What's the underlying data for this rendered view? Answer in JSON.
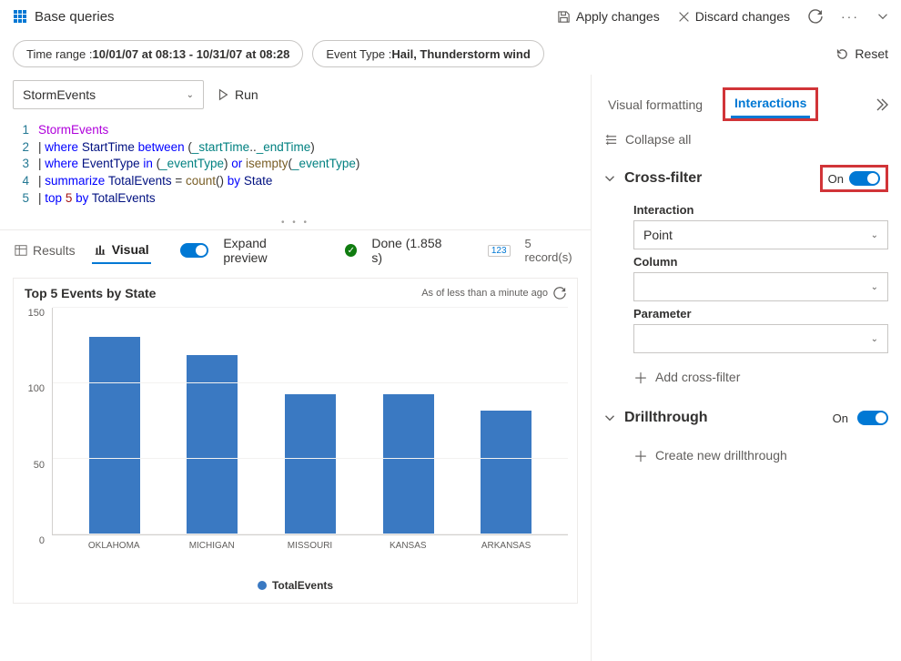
{
  "header": {
    "title": "Base queries",
    "apply": "Apply changes",
    "discard": "Discard changes"
  },
  "filters": {
    "timerange_label": "Time range : ",
    "timerange_value": "10/01/07 at 08:13 - 10/31/07 at 08:28",
    "eventtype_label": "Event Type : ",
    "eventtype_value": "Hail, Thunderstorm wind",
    "reset": "Reset"
  },
  "query": {
    "source_dropdown": "StormEvents",
    "run": "Run",
    "lines": {
      "l1_a": "StormEvents",
      "l2_pipe": "|",
      "l2_where": "where",
      "l2_col": "StartTime",
      "l2_between": "between",
      "l2_open": "(",
      "l2_p1": "_startTime",
      "l2_dots": "..",
      "l2_p2": "_endTime",
      "l2_close": ")",
      "l3_where": "where",
      "l3_col": "EventType",
      "l3_in": "in",
      "l3_open": "(",
      "l3_p": "_eventType",
      "l3_close": ")",
      "l3_or": "or",
      "l3_fn": "isempty",
      "l3_open2": "(",
      "l3_p2": "_eventType",
      "l3_close2": ")",
      "l4_sum": "summarize",
      "l4_alias": "TotalEvents",
      "l4_eq": " = ",
      "l4_fn": "count",
      "l4_paren": "()",
      "l4_by": "by",
      "l4_col": "State",
      "l5_top": "top",
      "l5_n": "5",
      "l5_by": "by",
      "l5_col": "TotalEvents"
    },
    "line_numbers": [
      "1",
      "2",
      "3",
      "4",
      "5"
    ]
  },
  "results_bar": {
    "results_tab": "Results",
    "visual_tab": "Visual",
    "expand": "Expand preview",
    "done": "Done (1.858 s)",
    "records_badge": "123",
    "records": "5 record(s)"
  },
  "chart": {
    "title": "Top 5 Events by State",
    "timeago": "As of less than a minute ago",
    "legend": "TotalEvents"
  },
  "chart_data": {
    "type": "bar",
    "categories": [
      "OKLAHOMA",
      "MICHIGAN",
      "MISSOURI",
      "KANSAS",
      "ARKANSAS"
    ],
    "values": [
      131,
      119,
      93,
      93,
      82
    ],
    "title": "Top 5 Events by State",
    "xlabel": "",
    "ylabel": "",
    "ylim": [
      0,
      150
    ],
    "yticks": [
      0,
      50,
      100,
      150
    ],
    "series_name": "TotalEvents"
  },
  "right_panel": {
    "tab_visual": "Visual formatting",
    "tab_interactions": "Interactions",
    "collapse_all": "Collapse all",
    "cross_filter": "Cross-filter",
    "on": "On",
    "interaction_label": "Interaction",
    "interaction_value": "Point",
    "column_label": "Column",
    "column_value": "",
    "parameter_label": "Parameter",
    "parameter_value": "",
    "add_crossfilter": "Add cross-filter",
    "drillthrough": "Drillthrough",
    "create_drill": "Create new drillthrough"
  }
}
